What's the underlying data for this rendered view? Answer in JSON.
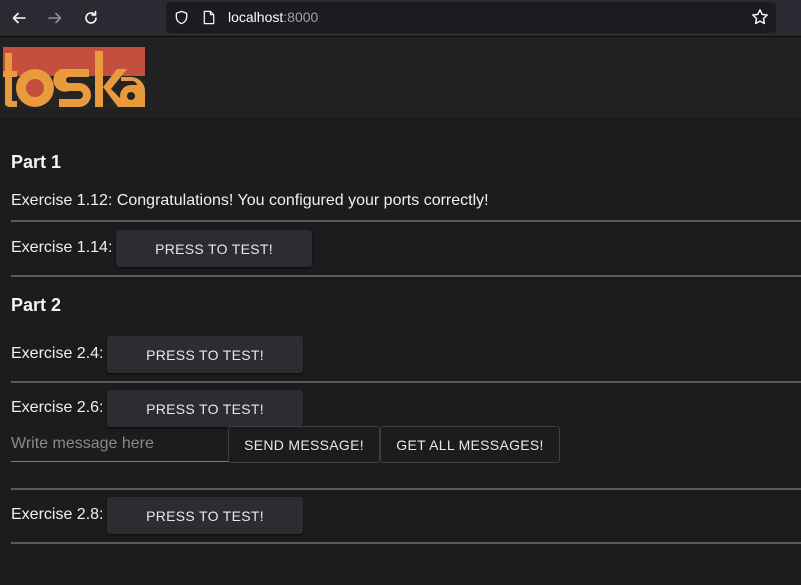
{
  "browser": {
    "url_host": "localhost",
    "url_port": ":8000"
  },
  "logo": {
    "alt": "toska"
  },
  "part1": {
    "title": "Part 1",
    "ex112_text": "Exercise 1.12: Congratulations! You configured your ports correctly!",
    "ex114_label": "Exercise 1.14:",
    "ex114_button": "PRESS TO TEST!"
  },
  "part2": {
    "title": "Part 2",
    "ex24_label": "Exercise 2.4:",
    "ex24_button": "PRESS TO TEST!",
    "ex26_label": "Exercise 2.6:",
    "ex26_button": "PRESS TO TEST!",
    "message_placeholder": "Write message here",
    "send_button": "SEND MESSAGE!",
    "get_all_button": "GET ALL MESSAGES!",
    "ex28_label": "Exercise 2.8:",
    "ex28_button": "PRESS TO TEST!"
  },
  "colors": {
    "logo_red": "#c44f3d",
    "logo_orange": "#e89a3c"
  }
}
